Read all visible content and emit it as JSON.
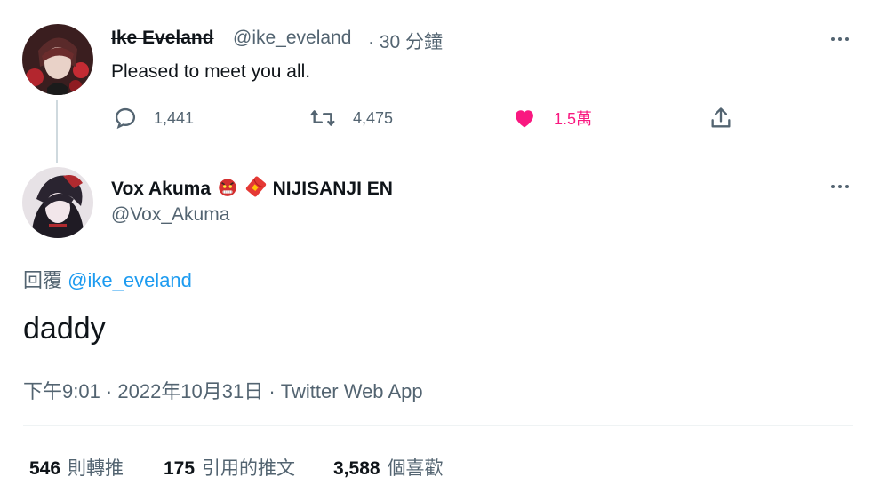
{
  "parent_tweet": {
    "display_name": "Ike Eveland",
    "handle": "@ike_eveland",
    "time": "· 30 分鐘",
    "text": "Pleased to meet you all.",
    "reply_count": "1,441",
    "retweet_count": "4,475",
    "like_count": "1.5萬",
    "like_color": "#f91880"
  },
  "main_tweet": {
    "display_name": "Vox Akuma",
    "name_suffix": "NIJISANJI EN",
    "handle": "@Vox_Akuma",
    "reply_prefix": "回覆",
    "reply_mention": "@ike_eveland",
    "text": "daddy",
    "timestamp": "下午9:01 · 2022年10月31日 · Twitter Web App",
    "mention_color": "#1d9bf0"
  },
  "stats": {
    "retweets_value": "546",
    "retweets_label": "則轉推",
    "quotes_value": "175",
    "quotes_label": "引用的推文",
    "likes_value": "3,588",
    "likes_label": "個喜歡"
  },
  "icons": [
    "reply-icon",
    "retweet-icon",
    "heart-icon",
    "share-icon",
    "more-icon",
    "ogre-emoji-icon",
    "red-envelope-emoji-icon"
  ]
}
